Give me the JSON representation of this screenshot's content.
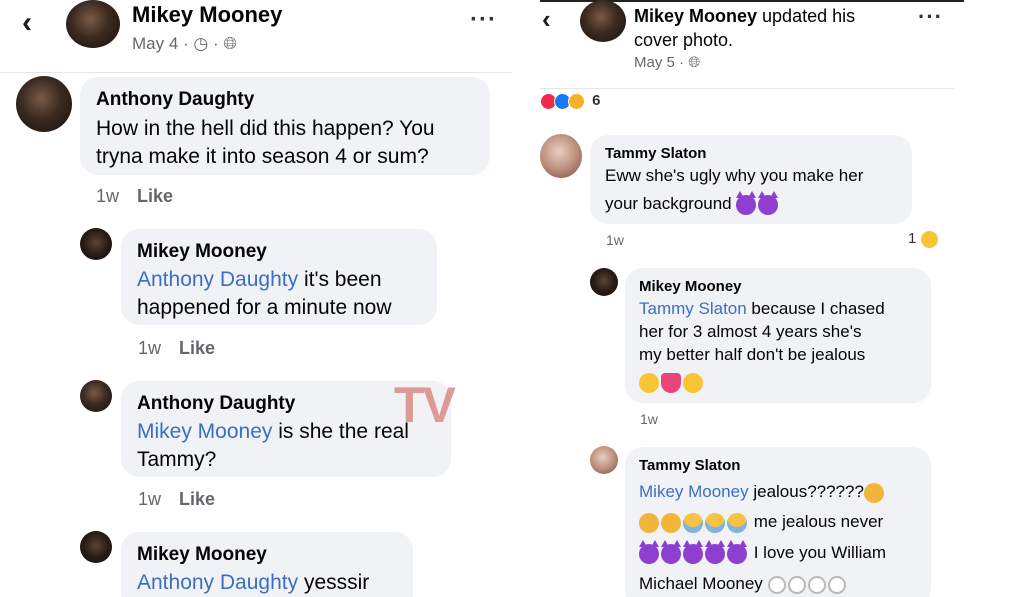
{
  "left": {
    "post": {
      "author": "Mikey Mooney",
      "date": "May 4 ·"
    },
    "comments": [
      {
        "author": "Anthony Daughty",
        "lines": [
          "How in the hell did this happen? You",
          "tryna make it into season 4 or sum?"
        ],
        "time": "1w",
        "like": "Like"
      },
      {
        "author": "Mikey Mooney",
        "mention": "Anthony Daughty",
        "line1_rest": " it's been",
        "line2": "happened for a minute now",
        "time": "1w",
        "like": "Like"
      },
      {
        "author": "Anthony Daughty",
        "mention": "Mikey Mooney",
        "line1_rest": " is she the real",
        "line2": "Tammy?",
        "time": "1w",
        "like": "Like"
      },
      {
        "author": "Mikey Mooney",
        "mention": "Anthony Daughty",
        "line1_rest": " yesssir"
      }
    ]
  },
  "watermark": "TV",
  "right": {
    "post": {
      "author": "Mikey Mooney",
      "action1": " updated his",
      "action2": "cover photo.",
      "date": "May 5 ·"
    },
    "reactions_count": "6",
    "comments": [
      {
        "author": "Tammy Slaton",
        "line1": "Eww she's ugly why you make her",
        "line2": "your background",
        "time": "1w",
        "reaction_count": "1"
      },
      {
        "author": "Mikey Mooney",
        "mention": "Tammy Slaton",
        "line1_rest": " because I chased",
        "line2": "her for 3 almost 4 years she's",
        "line3": "my better half don't be jealous",
        "time": "1w"
      },
      {
        "author": "Tammy Slaton",
        "mention": "Mikey Mooney",
        "line1_rest": " jealous??????",
        "line2": "me jealous never",
        "line3": "I love you William",
        "line4": "Michael Mooney"
      }
    ]
  }
}
